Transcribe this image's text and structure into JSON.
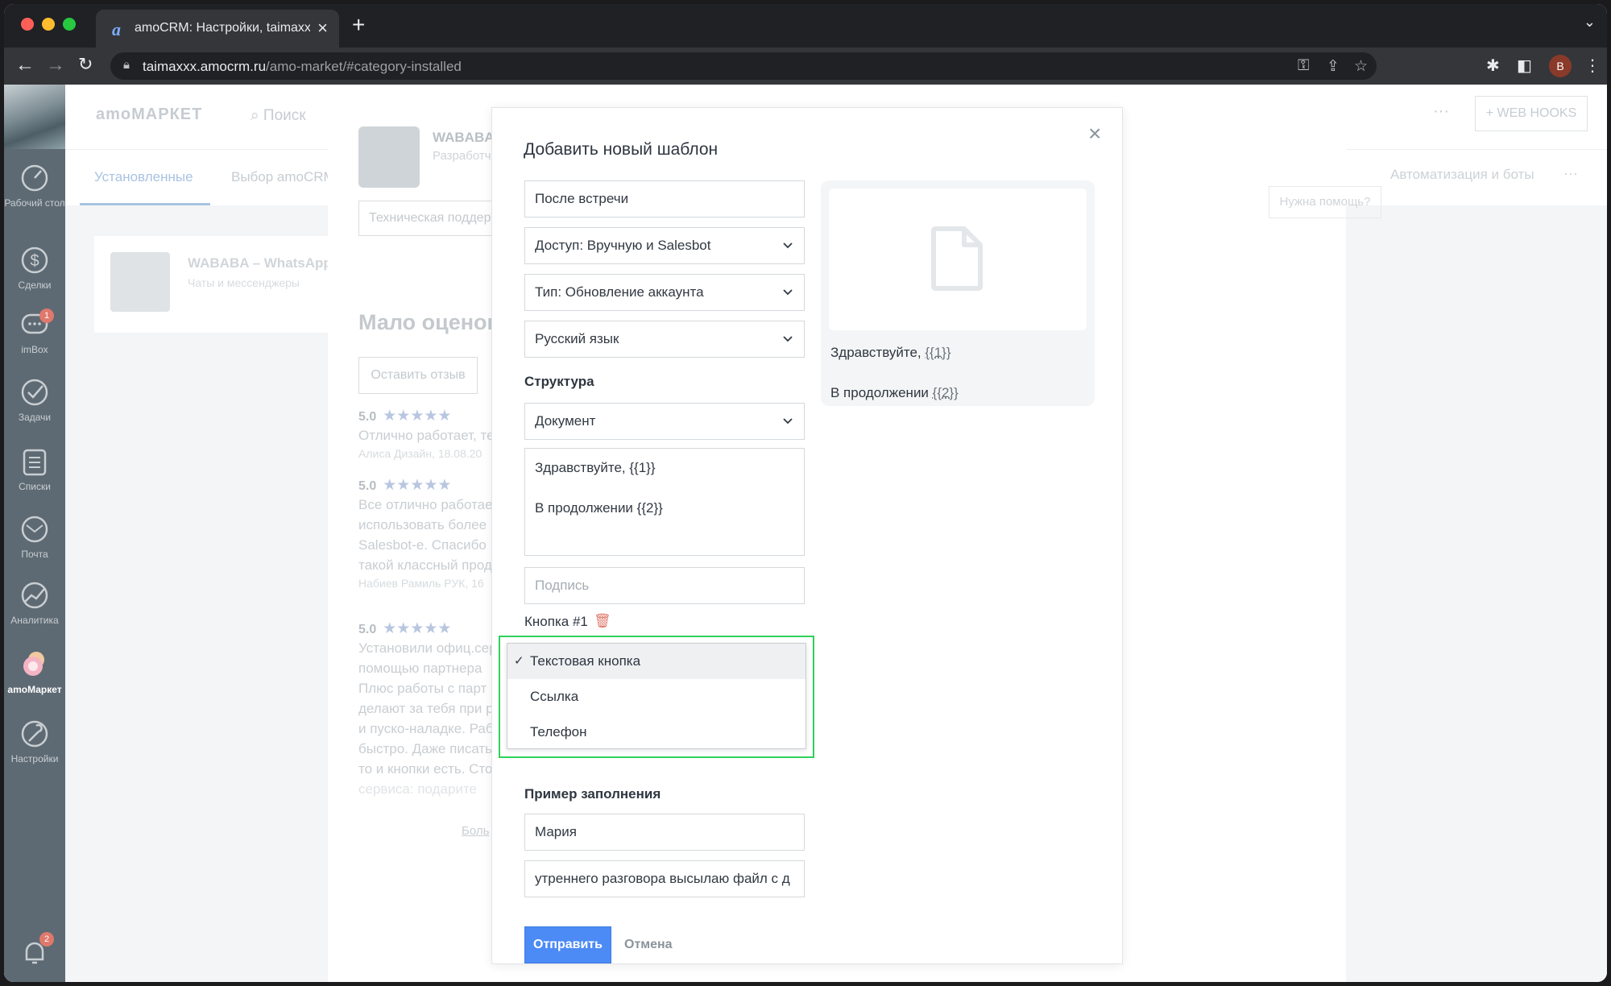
{
  "browser": {
    "tab_title": "amoCRM: Настройки, taimaxx",
    "tab_favicon": "a",
    "url_host": "taimaxxx.amocrm.ru",
    "url_path": "/amo-market/#category-installed",
    "profile_initial": "B"
  },
  "leftnav": {
    "items": [
      {
        "label": "Рабочий стол",
        "icon": "dashboard-icon"
      },
      {
        "label": "Сделки",
        "icon": "dollar-icon"
      },
      {
        "label": "imBox",
        "icon": "chat-icon",
        "badge": "1"
      },
      {
        "label": "Задачи",
        "icon": "check-icon"
      },
      {
        "label": "Списки",
        "icon": "list-icon"
      },
      {
        "label": "Почта",
        "icon": "mail-icon"
      },
      {
        "label": "Аналитика",
        "icon": "analytics-icon"
      },
      {
        "label": "amoМаркет",
        "icon": "market-icon"
      },
      {
        "label": "Настройки",
        "icon": "wrench-icon"
      }
    ],
    "bottom_badge": "2"
  },
  "background": {
    "logo": "amoМАРКЕТ",
    "search_placeholder": "Поиск",
    "webhooks": "+ WEB HOOKS",
    "more": "···",
    "tabs": [
      "Установленные",
      "Выбор amoCRM"
    ],
    "tab_right": "Автоматизация и боты",
    "help": "Нужна помощь?",
    "card_title": "WABABA – WhatsApp",
    "card_subtitle": "Чаты и мессенджеры",
    "app_name": "WABABA",
    "app_dev": "Разработчик",
    "support": "Техническая поддержка",
    "few_ratings": "Мало оценок",
    "leave_review": "Оставить отзыв",
    "reviews": [
      {
        "score": "5.0",
        "lines": [
          "Отлично работает, те"
        ],
        "author": "Алиса Дизайн, 18.08.20"
      },
      {
        "score": "5.0",
        "lines": [
          "Все отлично работае",
          "использовать более",
          "Salesbot-е. Спасибо",
          "такой классный прод"
        ],
        "author": "Набиев Рамиль РУК, 16"
      },
      {
        "score": "5.0",
        "lines": [
          "Установили офиц.сер",
          "помощью партнера",
          "Плюс работы с парт",
          "делают за тебя при р",
          "и пуско-наладке. Раб",
          "быстро. Даже писать",
          "то и кнопки есть. Сто",
          "сервиса: подарите"
        ],
        "author": ""
      }
    ],
    "more_link": "Боль"
  },
  "modal": {
    "title": "Добавить новый шаблон",
    "name_value": "После встречи",
    "access_value": "Доступ: Вручную и Salesbot",
    "type_value": "Тип: Обновление аккаунта",
    "language_value": "Русский язык",
    "structure_title": "Структура",
    "structure_value": "Документ",
    "body_lines": [
      "Здравствуйте, {{1}}",
      "В продолжении {{2}}"
    ],
    "signature_placeholder": "Подпись",
    "button_label": "Кнопка #1",
    "dropdown_options": [
      "Текстовая кнопка",
      "Ссылка",
      "Телефон"
    ],
    "dropdown_selected": "Текстовая кнопка",
    "example_title": "Пример заполнения",
    "example_1": "Мария",
    "example_2": "утреннего разговора высылаю файл с д",
    "send": "Отправить",
    "cancel": "Отмена"
  },
  "preview": {
    "greeting": "Здравствуйте, ",
    "var1": "{{1}}",
    "continuation": "В продолжении ",
    "var2": "{{2}}"
  },
  "colors": {
    "accent": "#4c8bf5",
    "highlight": "#2fd15a",
    "danger": "#e0786c",
    "nav_bg": "#5e6a73"
  }
}
